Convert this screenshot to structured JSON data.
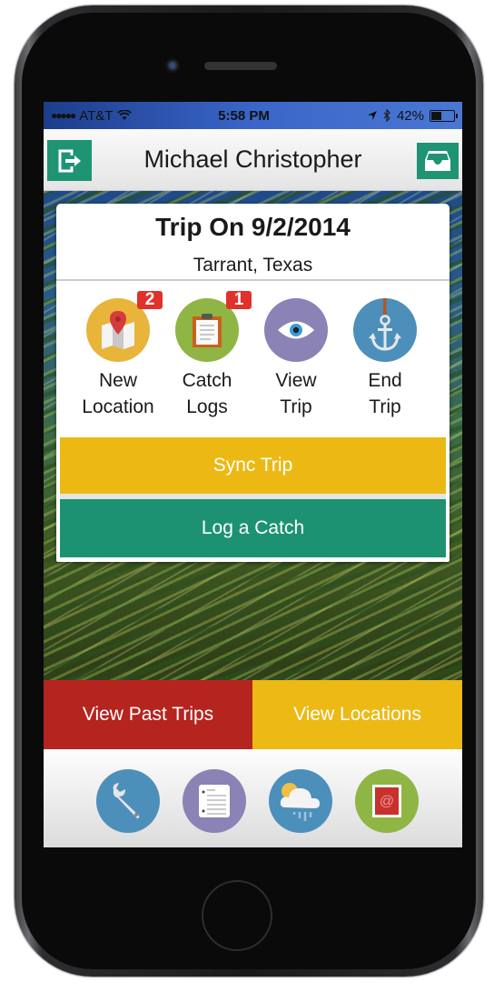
{
  "status_bar": {
    "signal_dots": "●●●●●",
    "carrier": "AT&T",
    "wifi_icon": "wifi-icon",
    "time": "5:58 PM",
    "location_icon": "location-arrow-icon",
    "bluetooth_icon": "bluetooth-icon",
    "battery_percent": "42%",
    "battery_level": 0.42
  },
  "header": {
    "title": "Michael Christopher",
    "left_button_icon": "logout-icon",
    "right_button_icon": "inbox-icon"
  },
  "trip_card": {
    "title": "Trip On 9/2/2014",
    "location": "Tarrant, Texas",
    "actions": [
      {
        "id": "new-location",
        "line1": "New",
        "line2": "Location",
        "icon": "map-pin-icon",
        "color": "#e8b53a",
        "badge": "2"
      },
      {
        "id": "catch-logs",
        "line1": "Catch",
        "line2": "Logs",
        "icon": "clipboard-icon",
        "color": "#8fb545",
        "badge": "1"
      },
      {
        "id": "view-trip",
        "line1": "View",
        "line2": "Trip",
        "icon": "eye-icon",
        "color": "#8b82b5",
        "badge": null
      },
      {
        "id": "end-trip",
        "line1": "End",
        "line2": "Trip",
        "icon": "anchor-icon",
        "color": "#4d8fbb",
        "badge": null
      }
    ],
    "sync_button": "Sync Trip",
    "log_button": "Log a Catch"
  },
  "bottom_tabs": {
    "past_trips": "View Past Trips",
    "locations": "View Locations"
  },
  "bottom_bar": [
    {
      "id": "settings",
      "icon": "wrench-icon",
      "color": "#4d8fbb"
    },
    {
      "id": "regulations",
      "icon": "list-document-icon",
      "color": "#8b82b5"
    },
    {
      "id": "weather",
      "icon": "weather-icon",
      "color": "#4d8fbb"
    },
    {
      "id": "contact",
      "icon": "email-stamp-icon",
      "color": "#8fb545"
    }
  ],
  "colors": {
    "green": "#1d9272",
    "yellow": "#ecb914",
    "red": "#b5241f",
    "badge_red": "#e0322b"
  }
}
